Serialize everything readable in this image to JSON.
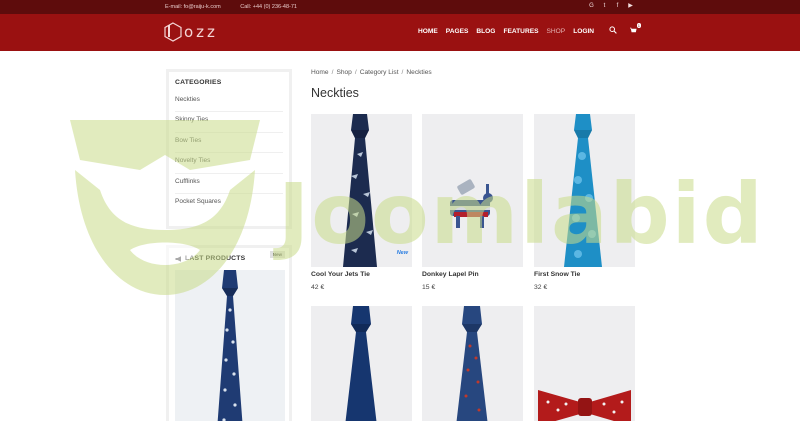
{
  "topbar": {
    "email": "E-mail: fo@raiju-k.com",
    "call": "Call: +44 (0) 236-48-71",
    "social": [
      {
        "icon": "google-icon",
        "glyph": "G"
      },
      {
        "icon": "twitter-icon",
        "glyph": "t"
      },
      {
        "icon": "facebook-icon",
        "glyph": "f"
      },
      {
        "icon": "youtube-icon",
        "glyph": "▶"
      }
    ]
  },
  "header": {
    "logo_text": "ozz",
    "nav": [
      "HOME",
      "PAGES",
      "BLOG",
      "FEATURES",
      "SHOP",
      "LOGIN"
    ],
    "active_nav": "SHOP",
    "cart_count": "1"
  },
  "sidebar": {
    "categories_title": "CATEGORIES",
    "categories": [
      "Neckties",
      "Skinny Ties",
      "Bow Ties",
      "Novelty Ties",
      "Cufflinks",
      "Pocket Squares"
    ],
    "last_products_title": "LAST PRODUCTS",
    "new_tag": "New"
  },
  "breadcrumb": [
    "Home",
    "Shop",
    "Category List",
    "Neckties"
  ],
  "page_title": "Neckties",
  "products": [
    {
      "name": "Cool Your Jets Tie",
      "price": "42 €",
      "badge": "New"
    },
    {
      "name": "Donkey Lapel Pin",
      "price": "15 €"
    },
    {
      "name": "First Snow Tie",
      "price": "32 €"
    },
    {
      "name": "",
      "price": ""
    },
    {
      "name": "",
      "price": ""
    },
    {
      "name": "",
      "price": ""
    }
  ],
  "watermark": "Joomlabid",
  "colors": {
    "topbar": "#5e0c0c",
    "header": "#9a1111",
    "watermark": "#c9dc8a"
  }
}
